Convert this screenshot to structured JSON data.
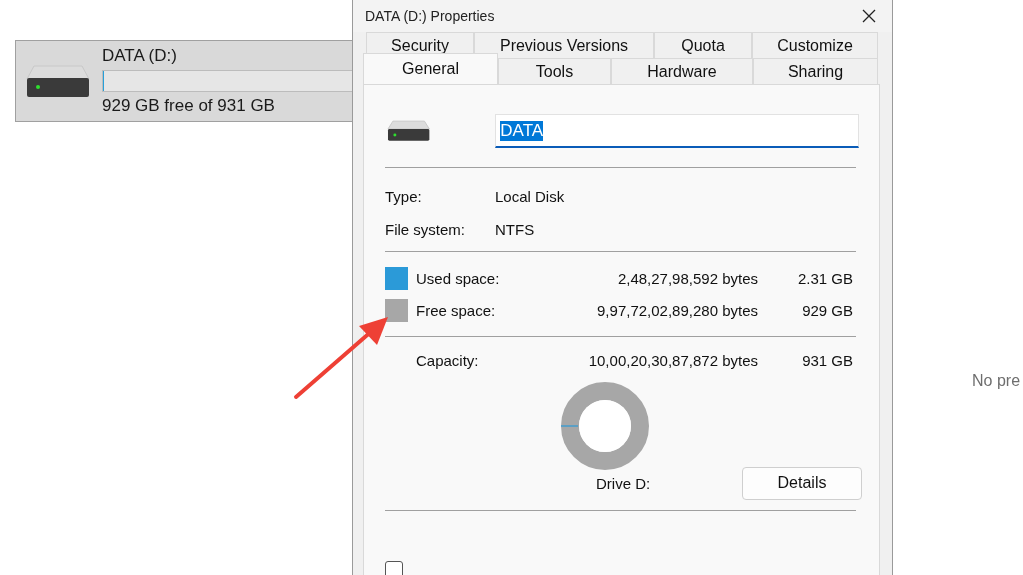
{
  "explorer": {
    "drive": {
      "name": "DATA (D:)",
      "level": 0.0025,
      "free_text": "929 GB free of 931 GB",
      "selected": true
    },
    "preview_text": "No pre"
  },
  "dialog": {
    "title": "DATA (D:) Properties",
    "tab_rows": [
      [
        {
          "label": "Security",
          "selected": false
        },
        {
          "label": "Previous Versions",
          "selected": false
        },
        {
          "label": "Quota",
          "selected": false
        },
        {
          "label": "Customize",
          "selected": false
        }
      ],
      [
        {
          "label": "General",
          "selected": true
        },
        {
          "label": "Tools",
          "selected": false
        },
        {
          "label": "Hardware",
          "selected": false
        },
        {
          "label": "Sharing",
          "selected": false
        }
      ]
    ],
    "name_field": {
      "value": "DATA"
    },
    "info": [
      {
        "label": "Type:",
        "value": "Local Disk"
      },
      {
        "label": "File system:",
        "value": "NTFS"
      }
    ],
    "space": [
      {
        "label": "Used space:",
        "bytes": "2,48,27,98,592 bytes",
        "size": "2.31 GB",
        "color": "#2b9ad8"
      },
      {
        "label": "Free space:",
        "bytes": "9,97,72,02,89,280 bytes",
        "size": "929 GB",
        "color": "#a7a7a7"
      }
    ],
    "capacity": {
      "label": "Capacity:",
      "bytes": "10,00,20,30,87,872 bytes",
      "size": "931 GB"
    },
    "drive_label": "Drive D:",
    "details_button": "Details",
    "compress_checkbox": {
      "checked": false
    }
  }
}
